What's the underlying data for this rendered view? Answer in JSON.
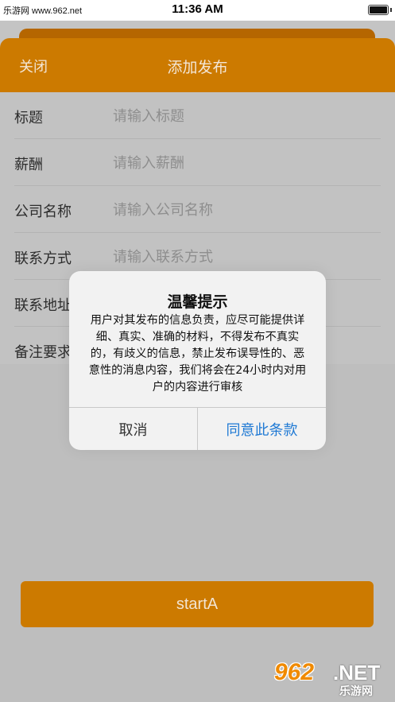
{
  "status_bar": {
    "watermark": "乐游网 www.962.net",
    "time": "11:36 AM"
  },
  "nav": {
    "close_label": "关闭",
    "title": "添加发布"
  },
  "form": {
    "rows": [
      {
        "label": "标题",
        "placeholder": "请输入标题"
      },
      {
        "label": "薪酬",
        "placeholder": "请输入薪酬"
      },
      {
        "label": "公司名称",
        "placeholder": "请输入公司名称"
      },
      {
        "label": "联系方式",
        "placeholder": "请输入联系方式"
      },
      {
        "label": "联系地址",
        "placeholder": ""
      },
      {
        "label": "备注要求",
        "placeholder": ""
      }
    ]
  },
  "start_button": {
    "label": "startA"
  },
  "modal": {
    "title": "温馨提示",
    "body": "用户对其发布的信息负责，应尽可能提供详细、真实、准确的材料，不得发布不真实的，有歧义的信息，禁止发布误导性的、恶意性的消息内容，我们将会在24小时内对用户的内容进行审核",
    "cancel_label": "取消",
    "agree_label": "同意此条款"
  },
  "logo": {
    "number": "962",
    "suffix": ".NET",
    "cn": "乐游网"
  },
  "colors": {
    "accent": "#cc7a00",
    "link_blue": "#1f79d4"
  }
}
